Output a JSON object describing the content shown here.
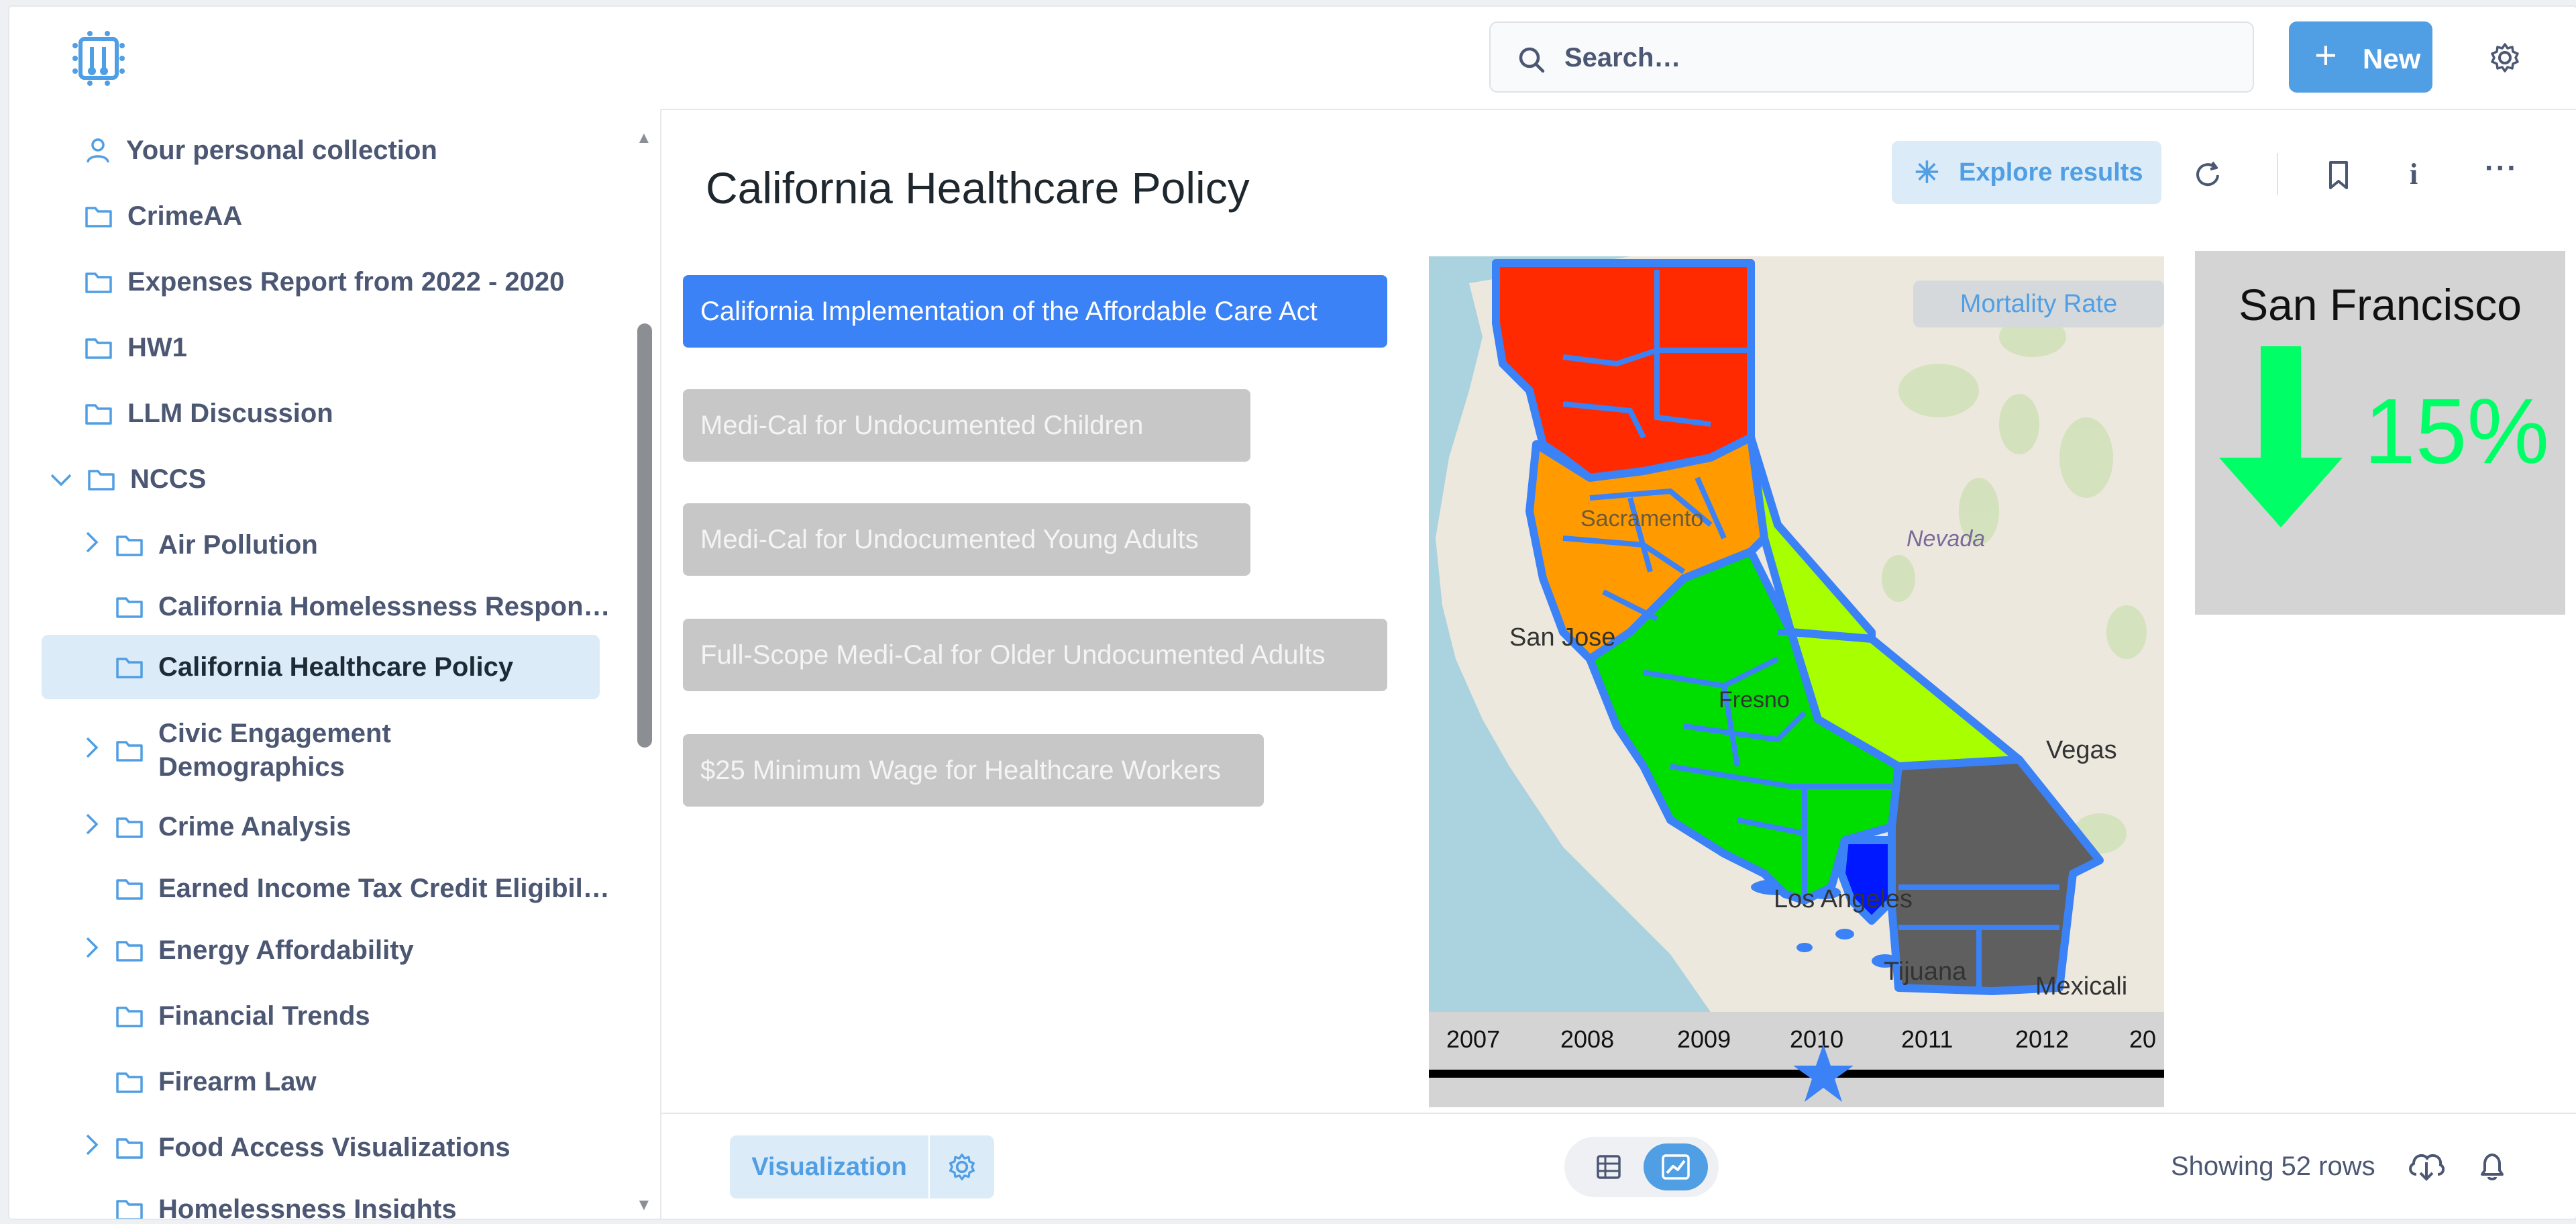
{
  "search": {
    "placeholder": "Search…"
  },
  "header": {
    "new_label": "New"
  },
  "sidebar": {
    "items": [
      {
        "label": "Your personal collection",
        "icon": "person-icon",
        "expandable": false
      },
      {
        "label": "CrimeAA",
        "icon": "folder-icon",
        "expandable": false
      },
      {
        "label": "Expenses Report from 2022 - 2020",
        "icon": "folder-icon",
        "expandable": false
      },
      {
        "label": "HW1",
        "icon": "folder-icon",
        "expandable": false
      },
      {
        "label": "LLM Discussion",
        "icon": "folder-icon",
        "expandable": false
      },
      {
        "label": "NCCS",
        "icon": "folder-icon",
        "expandable": true,
        "expanded": true
      },
      {
        "label": "Air Pollution",
        "icon": "folder-icon",
        "expandable": true
      },
      {
        "label": "California Homelessness Respons…",
        "icon": "folder-icon",
        "expandable": false
      },
      {
        "label": "California Healthcare Policy",
        "icon": "folder-icon",
        "expandable": false,
        "selected": true
      },
      {
        "label": "Civic Engagement",
        "label2": "Demographics",
        "icon": "folder-icon",
        "expandable": true
      },
      {
        "label": "Crime Analysis",
        "icon": "folder-icon",
        "expandable": true
      },
      {
        "label": "Earned Income Tax Credit Eligibili…",
        "icon": "folder-icon",
        "expandable": false
      },
      {
        "label": "Energy Affordability",
        "icon": "folder-icon",
        "expandable": true
      },
      {
        "label": "Financial Trends",
        "icon": "folder-icon",
        "expandable": false
      },
      {
        "label": "Firearm Law",
        "icon": "folder-icon",
        "expandable": false
      },
      {
        "label": "Food Access Visualizations",
        "icon": "folder-icon",
        "expandable": true
      },
      {
        "label": "Homelessness Insights",
        "icon": "folder-icon",
        "expandable": false
      }
    ]
  },
  "main": {
    "title": "California Healthcare Policy",
    "explore_label": "Explore results",
    "policies": [
      {
        "label": "California Implementation of the Affordable Care Act",
        "active": true
      },
      {
        "label": "Medi-Cal for Undocumented Children",
        "active": false
      },
      {
        "label": "Medi-Cal for Undocumented Young Adults",
        "active": false
      },
      {
        "label": "Full-Scope Medi-Cal for Older Undocumented Adults",
        "active": false
      },
      {
        "label": "$25 Minimum Wage for Healthcare Workers",
        "active": false
      }
    ],
    "map": {
      "metric_label": "Mortality Rate",
      "place_labels": [
        "Nevada",
        "San Jose",
        "Vegas",
        "Fresno",
        "Los Angeles",
        "Tijuana",
        "Mexicali",
        "Sacramento"
      ],
      "timeline": {
        "years": [
          "2007",
          "2008",
          "2009",
          "2010",
          "2011",
          "2012",
          "20"
        ],
        "selected": "2010"
      },
      "colors": {
        "red": "#ff2a00",
        "orange": "#ff9a00",
        "green": "#00dd00",
        "lime": "#a8ff00",
        "gray": "#5f5f5f",
        "blue": "#0018ff",
        "border": "#3b82f6"
      }
    },
    "stat": {
      "city": "San Francisco",
      "change": "15%",
      "direction": "down",
      "color": "#00ff66"
    }
  },
  "footer": {
    "visualization_label": "Visualization",
    "rows_label": "Showing 52 rows"
  },
  "colors": {
    "accent": "#509ee3",
    "selected_bg": "#dcebf8"
  }
}
